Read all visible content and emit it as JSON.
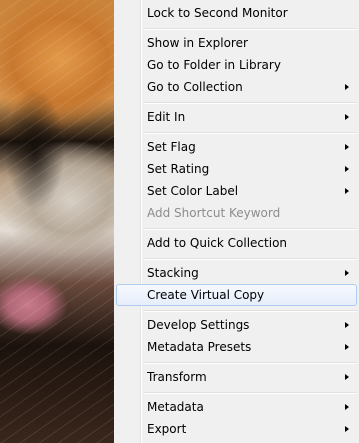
{
  "context_menu": {
    "items": [
      {
        "label": "Lock to Second Monitor",
        "submenu": false,
        "disabled": false
      },
      {
        "label": "Show in Explorer",
        "submenu": false,
        "disabled": false
      },
      {
        "label": "Go to Folder in Library",
        "submenu": false,
        "disabled": false
      },
      {
        "label": "Go to Collection",
        "submenu": true,
        "disabled": false
      },
      {
        "label": "Edit In",
        "submenu": true,
        "disabled": false
      },
      {
        "label": "Set Flag",
        "submenu": true,
        "disabled": false
      },
      {
        "label": "Set Rating",
        "submenu": true,
        "disabled": false
      },
      {
        "label": "Set Color Label",
        "submenu": true,
        "disabled": false
      },
      {
        "label": "Add Shortcut Keyword",
        "submenu": false,
        "disabled": true
      },
      {
        "label": "Add to Quick Collection",
        "submenu": false,
        "disabled": false
      },
      {
        "label": "Stacking",
        "submenu": true,
        "disabled": false
      },
      {
        "label": "Create Virtual Copy",
        "submenu": false,
        "disabled": false,
        "highlighted": true
      },
      {
        "label": "Develop Settings",
        "submenu": true,
        "disabled": false
      },
      {
        "label": "Metadata Presets",
        "submenu": true,
        "disabled": false
      },
      {
        "label": "Transform",
        "submenu": true,
        "disabled": false
      },
      {
        "label": "Metadata",
        "submenu": true,
        "disabled": false
      },
      {
        "label": "Export",
        "submenu": true,
        "disabled": false
      }
    ]
  },
  "colors": {
    "menu_background": "#f0f0f0",
    "highlight_border": "#aecbf1",
    "disabled_text": "#8d8d8d"
  }
}
